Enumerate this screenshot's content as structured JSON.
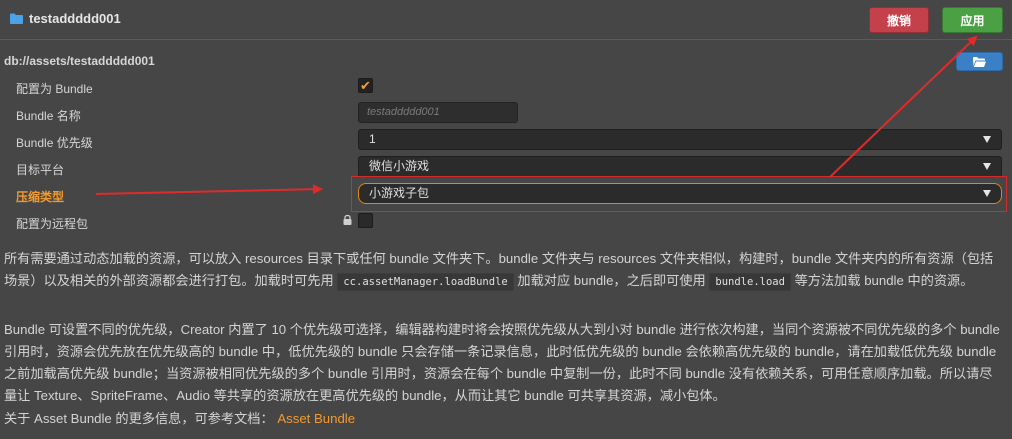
{
  "header": {
    "title": "testaddddd001",
    "revert_label": "撤销",
    "apply_label": "应用"
  },
  "path": "db://assets/testaddddd001",
  "fields": {
    "config_bundle_label": "配置为 Bundle",
    "config_bundle_checked": true,
    "bundle_name_label": "Bundle 名称",
    "bundle_name_placeholder": "testaddddd001",
    "bundle_priority_label": "Bundle 优先级",
    "bundle_priority_value": "1",
    "target_platform_label": "目标平台",
    "target_platform_value": "微信小游戏",
    "compression_label": "压缩类型",
    "compression_value": "小游戏子包",
    "remote_label": "配置为远程包",
    "remote_checked": false
  },
  "description": {
    "p1_a": "所有需要通过动态加载的资源，可以放入 resources 目录下或任何 bundle 文件夹下。bundle 文件夹与 resources 文件夹相似，构建时，bundle 文件夹内的所有资源（包括场景）以及相关的外部资源都会进行打包。加载时可先用 ",
    "p1_code1": "cc.assetManager.loadBundle",
    "p1_b": " 加载对应 bundle，之后即可使用 ",
    "p1_code2": "bundle.load",
    "p1_c": " 等方法加载 bundle 中的资源。",
    "p2": "Bundle 可设置不同的优先级，Creator 内置了 10 个优先级可选择，编辑器构建时将会按照优先级从大到小对 bundle 进行依次构建，当同个资源被不同优先级的多个 bundle 引用时，资源会优先放在优先级高的 bundle 中，低优先级的 bundle 只会存储一条记录信息，此时低优先级的 bundle 会依赖高优先级的 bundle，请在加载低优先级 bundle 之前加载高优先级 bundle；当资源被相同优先级的多个 bundle 引用时，资源会在每个 bundle 中复制一份，此时不同 bundle 没有依赖关系，可用任意顺序加载。所以请尽量让 Texture、SpriteFrame、Audio 等共享的资源放在更高优先级的 bundle，从而让其它 bundle 可共享其资源，减小包体。",
    "p3_prefix": "关于 Asset Bundle 的更多信息，可参考文档：",
    "p3_link": "Asset Bundle"
  },
  "icons": [
    "folder-icon",
    "open-folder-icon",
    "checkmark-icon",
    "lock-icon",
    "dropdown-arrow-icon"
  ],
  "colors": {
    "background": "#464646",
    "revert_button": "#c4404a",
    "apply_button": "#4aa043",
    "accent_orange": "#f29a2e",
    "annotation_red": "#e02b2b"
  }
}
